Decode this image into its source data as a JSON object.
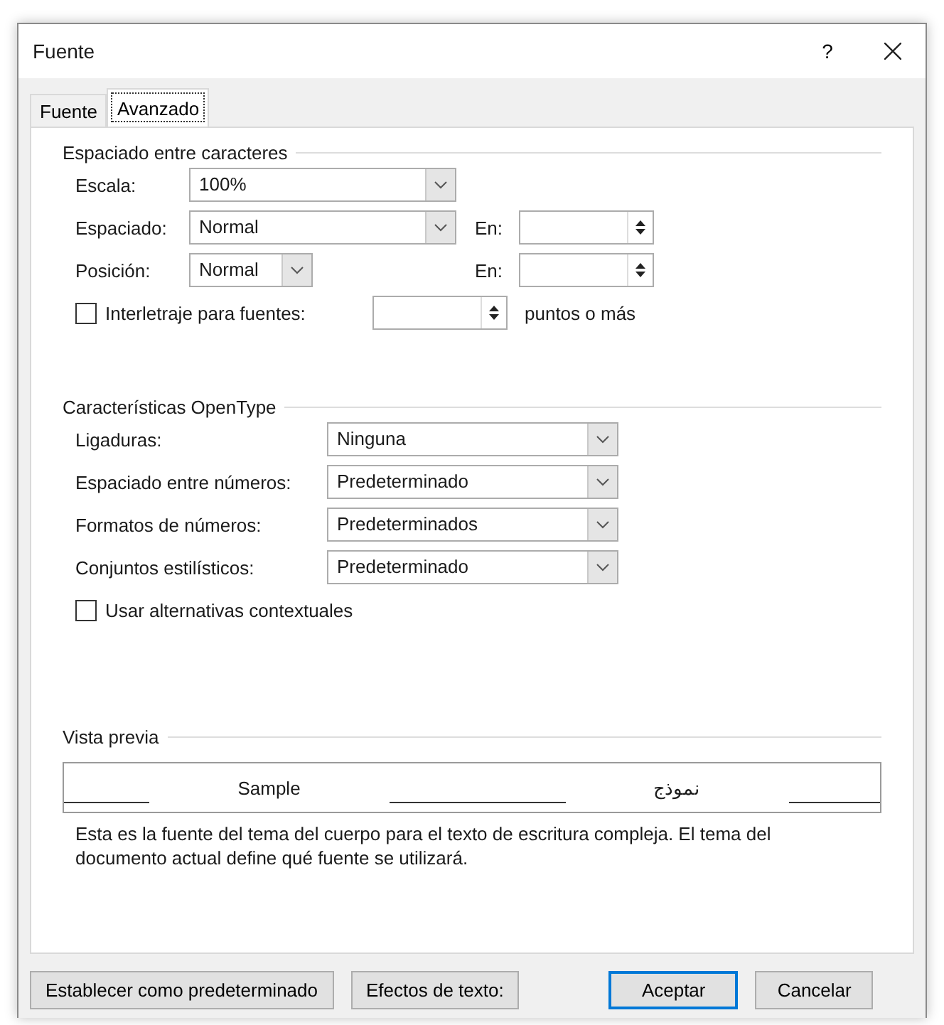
{
  "window": {
    "title": "Fuente",
    "help": "?"
  },
  "tabs": [
    {
      "label": "Fuente",
      "selected": false
    },
    {
      "label": "Avanzado",
      "selected": true
    }
  ],
  "sections": [
    {
      "title": "Espaciado entre caracteres",
      "rows": [
        {
          "kind": "combo",
          "label": "Escala:",
          "value": "100%"
        },
        {
          "kind": "combo",
          "label": "Espaciado:",
          "value": "Normal",
          "spin_label": "En:"
        },
        {
          "kind": "combo_narrow",
          "label": "Posición:",
          "value": "Normal",
          "spin_label": "En:"
        },
        {
          "kind": "check",
          "label": "Interletraje para fuentes:",
          "checked": false,
          "spin": true,
          "suffix": "puntos o más"
        }
      ]
    },
    {
      "title": "Características OpenType",
      "rows": [
        {
          "kind": "combo2",
          "label": "Ligaduras:",
          "value": "Ninguna"
        },
        {
          "kind": "combo2",
          "label": "Espaciado entre números:",
          "value": "Predeterminado"
        },
        {
          "kind": "combo2",
          "label": "Formatos de números:",
          "value": "Predeterminados"
        },
        {
          "kind": "combo2",
          "label": "Conjuntos estilísticos:",
          "value": "Predeterminado"
        },
        {
          "kind": "check",
          "label": "Usar alternativas contextuales",
          "checked": false
        }
      ]
    }
  ],
  "preview": {
    "title": "Vista previa",
    "sample": "Sample",
    "sample_rtl": "نموذج",
    "description": "Esta es la fuente del tema del cuerpo para el texto de escritura compleja. El tema del documento actual define qué fuente se utilizará."
  },
  "buttons": [
    {
      "label": "Establecer como predeterminado",
      "default": false
    },
    {
      "label": "Efectos de texto:",
      "default": false
    },
    {
      "label": "Aceptar",
      "default": true
    },
    {
      "label": "Cancelar",
      "default": false
    }
  ]
}
